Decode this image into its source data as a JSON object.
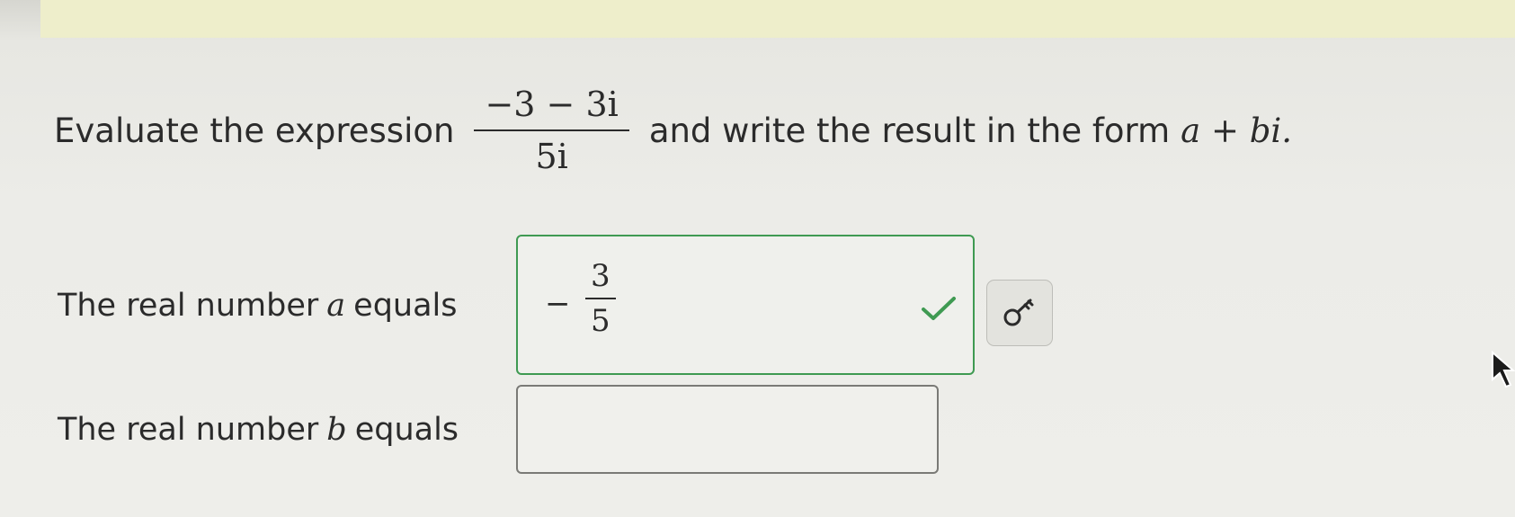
{
  "question": {
    "prefix": "Evaluate the expression",
    "numerator": "−3 − 3i",
    "denominator": "5i",
    "middle": "and write the result in the form",
    "form": "a + bi."
  },
  "part_a": {
    "label_before": "The real number",
    "variable": "a",
    "label_after": "equals",
    "answer_sign": "−",
    "answer_numerator": "3",
    "answer_denominator": "5",
    "status": "correct",
    "status_icon": "check-icon"
  },
  "part_b": {
    "label_before": "The real number",
    "variable": "b",
    "label_after": "equals",
    "value": ""
  },
  "help_button": {
    "icon": "key-icon"
  },
  "colors": {
    "correct": "#3f9a52",
    "text": "#2b2b2b"
  }
}
